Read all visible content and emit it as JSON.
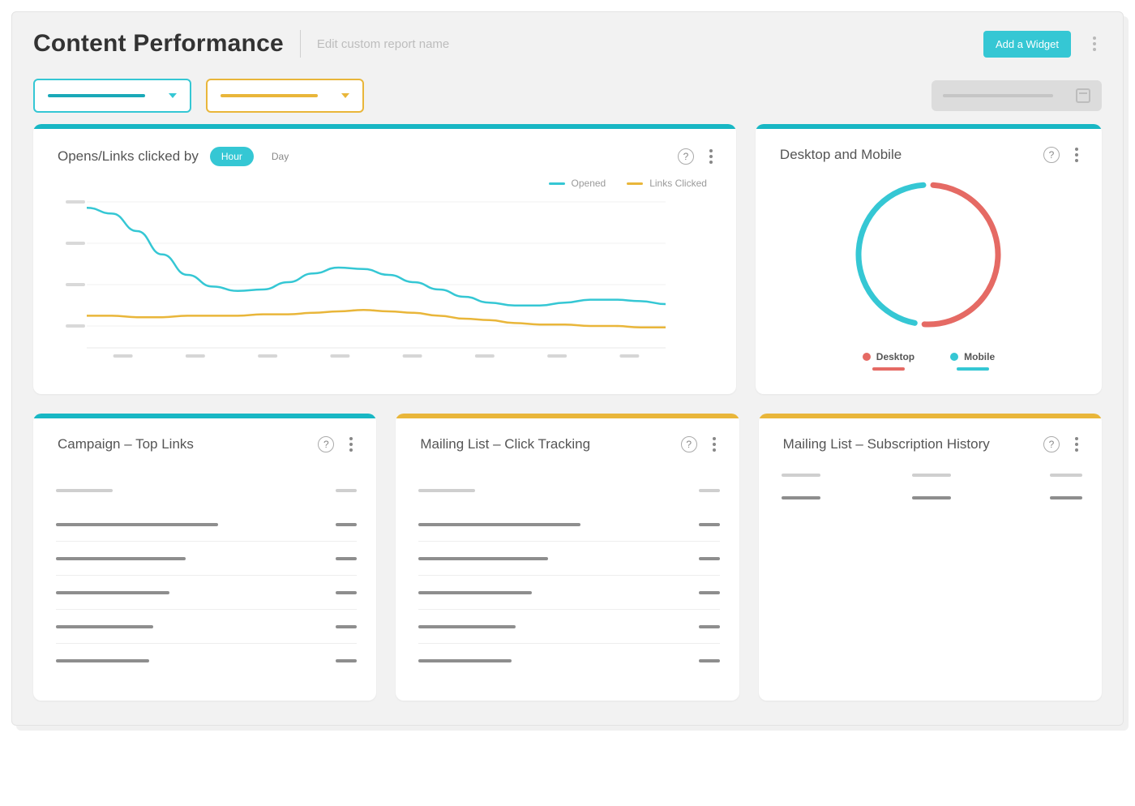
{
  "header": {
    "title": "Content Performance",
    "subtitle": "Edit custom report name",
    "add_widget_label": "Add a Widget"
  },
  "colors": {
    "teal": "#35c7d4",
    "teal_dark": "#18b7c4",
    "yellow": "#e9b63a",
    "red": "#e56a64"
  },
  "widgets": {
    "opens_links": {
      "title": "Opens/Links clicked by",
      "toggles": {
        "hour": "Hour",
        "day": "Day",
        "active": "hour"
      },
      "legend": {
        "opened": "Opened",
        "links_clicked": "Links Clicked"
      }
    },
    "desktop_mobile": {
      "title": "Desktop and Mobile",
      "legend": {
        "desktop": "Desktop",
        "mobile": "Mobile"
      }
    },
    "top_links": {
      "title": "Campaign – Top Links"
    },
    "click_tracking": {
      "title": "Mailing List – Click Tracking"
    },
    "sub_history": {
      "title": "Mailing List – Subscription History"
    }
  },
  "chart_data": [
    {
      "id": "opens_links_clicked",
      "type": "line",
      "title": "Opens/Links clicked by Hour",
      "x": [
        0,
        1,
        2,
        3,
        4,
        5,
        6,
        7,
        8,
        9,
        10,
        11,
        12,
        13,
        14,
        15,
        16,
        17,
        18,
        19,
        20,
        21,
        22,
        23
      ],
      "ylim": [
        0,
        100
      ],
      "series": [
        {
          "name": "Opened",
          "color": "#35c7d4",
          "values": [
            96,
            92,
            80,
            64,
            50,
            42,
            39,
            40,
            45,
            51,
            55,
            54,
            50,
            45,
            40,
            35,
            31,
            29,
            29,
            31,
            33,
            33,
            32,
            30
          ]
        },
        {
          "name": "Links Clicked",
          "color": "#e9b63a",
          "values": [
            22,
            22,
            21,
            21,
            22,
            22,
            22,
            23,
            23,
            24,
            25,
            26,
            25,
            24,
            22,
            20,
            19,
            17,
            16,
            16,
            15,
            15,
            14,
            14
          ]
        }
      ]
    },
    {
      "id": "desktop_vs_mobile",
      "type": "pie",
      "title": "Desktop and Mobile",
      "series": [
        {
          "name": "Desktop",
          "value": 52,
          "color": "#e56a64"
        },
        {
          "name": "Mobile",
          "value": 48,
          "color": "#35c7d4"
        }
      ]
    }
  ]
}
